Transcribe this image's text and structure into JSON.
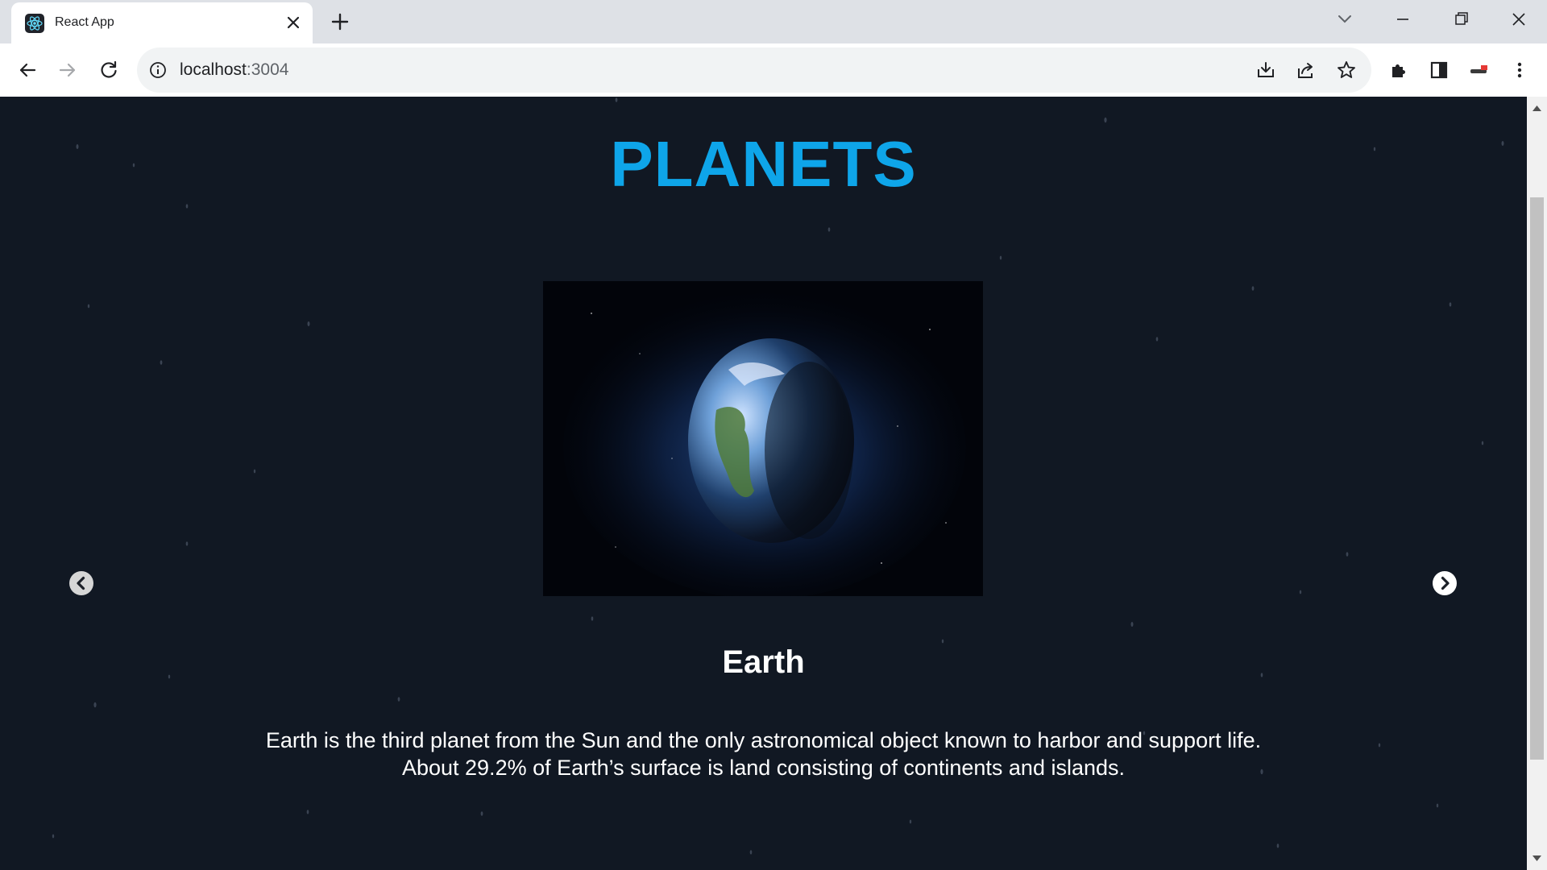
{
  "browser": {
    "tab_title": "React App",
    "url_host": "localhost",
    "url_port": ":3004"
  },
  "page": {
    "title": "PLANETS",
    "slide": {
      "name": "Earth",
      "description": "Earth is the third planet from the Sun and the only astronomical object known to harbor and support life. About 29.2% of Earth’s surface is land consisting of continents and islands.",
      "image_alt": "Earth"
    }
  },
  "colors": {
    "page_background": "#111823",
    "title": "#0ea5e9",
    "text": "#ffffff"
  },
  "icons": {
    "tab_favicon": "react-logo-icon",
    "tab_close": "close-icon",
    "new_tab": "plus-icon",
    "back": "arrow-left-icon",
    "forward": "arrow-right-icon",
    "reload": "reload-icon",
    "site_info": "info-icon",
    "install": "install-icon",
    "share": "share-icon",
    "bookmark": "star-icon",
    "extensions": "puzzle-icon",
    "side_panel": "side-panel-icon",
    "profile": "profile-avatar-icon",
    "menu": "kebab-menu-icon",
    "carousel_prev": "chevron-left-circle-icon",
    "carousel_next": "chevron-right-circle-icon"
  }
}
